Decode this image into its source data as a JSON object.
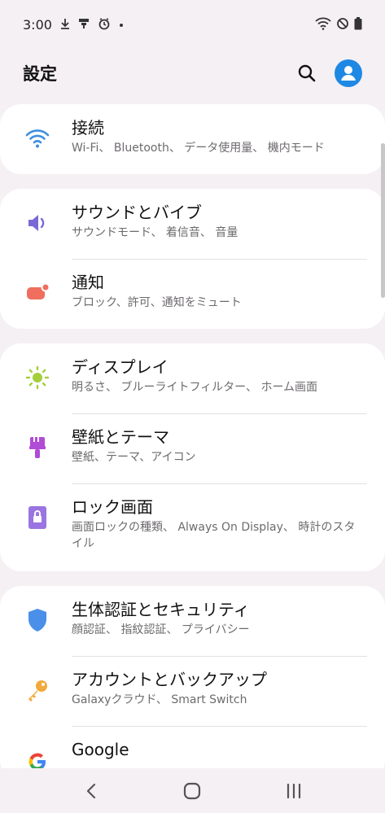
{
  "status_bar": {
    "time": "3:00",
    "icons": [
      "download-icon",
      "usb-icon",
      "sync-icon",
      "dot-icon",
      "wifi-icon",
      "no-disturb-icon",
      "battery-icon"
    ]
  },
  "header": {
    "title": "設定",
    "search_icon": "search-icon",
    "avatar_icon": "account-icon"
  },
  "sections": [
    {
      "items": [
        {
          "title": "接続",
          "subtitle": "Wi-Fi、 Bluetooth、 データ使用量、 機内モード",
          "icon": "wifi-icon",
          "color": "#3d8fe0"
        }
      ]
    },
    {
      "items": [
        {
          "title": "サウンドとバイブ",
          "subtitle": "サウンドモード、 着信音、 音量",
          "icon": "speaker-icon",
          "color": "#7b68d6"
        },
        {
          "title": "通知",
          "subtitle": "ブロック、許可、通知をミュート",
          "icon": "notification-icon",
          "color": "#ef6e5e"
        }
      ]
    },
    {
      "items": [
        {
          "title": "ディスプレイ",
          "subtitle": "明るさ、 ブルーライトフィルター、 ホーム画面",
          "icon": "brightness-icon",
          "color": "#a4cf3a"
        },
        {
          "title": "壁紙とテーマ",
          "subtitle": "壁紙、テーマ、アイコン",
          "icon": "paintbrush-icon",
          "color": "#b04cd6"
        },
        {
          "title": "ロック画面",
          "subtitle": "画面ロックの種類、 Always On Display、 時計のスタイル",
          "icon": "lock-icon",
          "color": "#9a74e0"
        }
      ]
    },
    {
      "items": [
        {
          "title": "生体認証とセキュリティ",
          "subtitle": "顔認証、 指紋認証、 プライバシー",
          "icon": "shield-icon",
          "color": "#4a8fe8"
        },
        {
          "title": "アカウントとバックアップ",
          "subtitle": "Galaxyクラウド、 Smart Switch",
          "icon": "key-icon",
          "color": "#f2a93b"
        },
        {
          "title": "Google",
          "subtitle": "",
          "icon": "google-icon",
          "color": "#4285f4"
        }
      ]
    }
  ],
  "nav_bar": {
    "back_icon": "back-icon",
    "home_icon": "home-icon",
    "recents_icon": "recents-icon"
  }
}
